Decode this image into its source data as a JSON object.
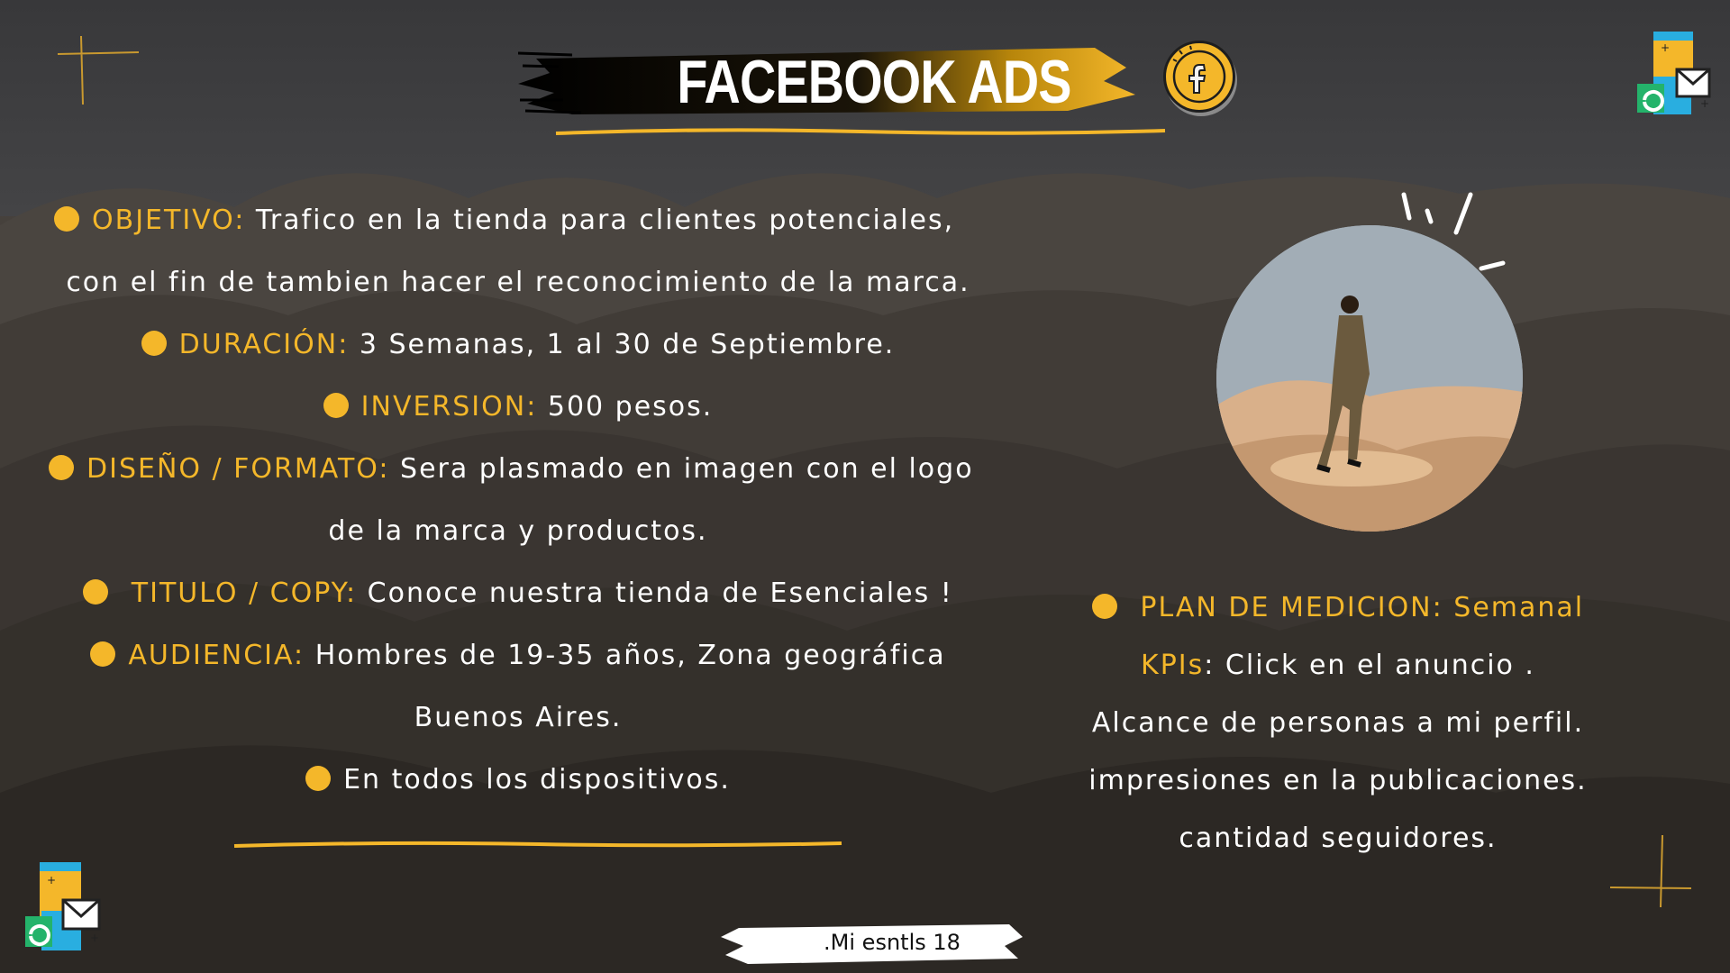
{
  "header": {
    "title": "FACEBOOK ADS",
    "icon": "facebook-icon"
  },
  "colors": {
    "accent": "#f4b72a",
    "text": "#ffffff",
    "background": "#2f2b27"
  },
  "left": {
    "objetivo_label": "OBJETIVO:",
    "objetivo_text": "Trafico en la tienda para clientes potenciales,",
    "objetivo_text2": "con el fin de tambien hacer el reconocimiento de la marca.",
    "duracion_label": "DURACIÓN:",
    "duracion_text": "3 Semanas, 1 al 30 de Septiembre.",
    "inversion_label": "INVERSION:",
    "inversion_text": "500 pesos.",
    "diseno_label": "DISEÑO / FORMATO:",
    "diseno_text": "Sera plasmado en imagen con el logo",
    "diseno_text2": "de la marca y productos.",
    "titulo_label": "TITULO / COPY:",
    "titulo_text": "Conoce nuestra tienda de Esenciales !",
    "audiencia_label": "AUDIENCIA:",
    "audiencia_text": "Hombres de 19-35 años, Zona geográfica",
    "audiencia_text2": "Buenos Aires.",
    "dispositivos_text": "En todos los dispositivos."
  },
  "right": {
    "plan_label": "PLAN DE MEDICION: Semanal",
    "kpis_label": "KPIs",
    "kpis_text": ": Click en el anuncio .",
    "kpi_line2": "Alcance de personas a mi perfil.",
    "kpi_line3": "impresiones en la publicaciones.",
    "kpi_line4": "cantidad seguidores."
  },
  "footer": {
    "brand": ".Mi esntls",
    "page_number": "18"
  }
}
